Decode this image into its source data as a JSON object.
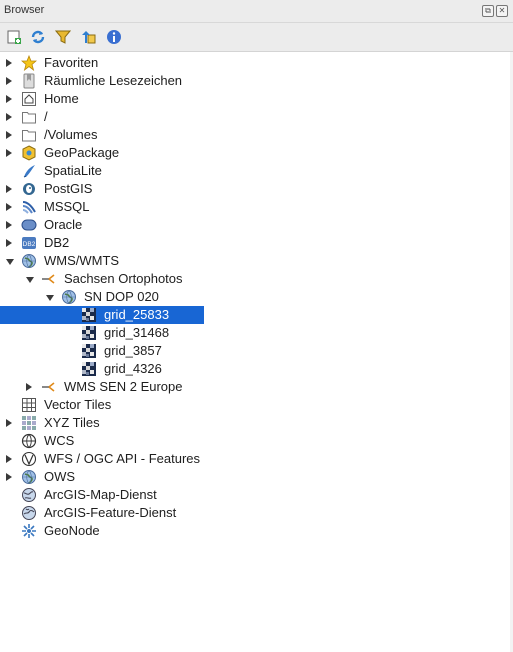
{
  "panel": {
    "title": "Browser"
  },
  "toolbar": {
    "icons": [
      "add-selected-icon",
      "refresh-icon",
      "filter-icon",
      "collapse-all-icon",
      "info-icon"
    ]
  },
  "tree": {
    "items": [
      {
        "label": "Favoriten",
        "icon": "star-icon",
        "expand": "collapsed"
      },
      {
        "label": "Räumliche Lesezeichen",
        "icon": "bookmark-icon",
        "expand": "collapsed"
      },
      {
        "label": "Home",
        "icon": "home-icon",
        "expand": "collapsed"
      },
      {
        "label": "/",
        "icon": "folder-icon",
        "expand": "collapsed"
      },
      {
        "label": "/Volumes",
        "icon": "folder-icon",
        "expand": "collapsed"
      },
      {
        "label": "GeoPackage",
        "icon": "geopackage-icon",
        "expand": "collapsed"
      },
      {
        "label": "SpatiaLite",
        "icon": "spatialite-icon",
        "expand": "none"
      },
      {
        "label": "PostGIS",
        "icon": "postgis-icon",
        "expand": "collapsed"
      },
      {
        "label": "MSSQL",
        "icon": "mssql-icon",
        "expand": "collapsed"
      },
      {
        "label": "Oracle",
        "icon": "oracle-icon",
        "expand": "collapsed"
      },
      {
        "label": "DB2",
        "icon": "db2-icon",
        "expand": "collapsed"
      },
      {
        "label": "WMS/WMTS",
        "icon": "globe-icon",
        "expand": "expanded"
      },
      {
        "label": "Sachsen Ortophotos",
        "icon": "connection-icon",
        "expand": "expanded"
      },
      {
        "label": "SN DOP 020",
        "icon": "globe-icon",
        "expand": "expanded"
      },
      {
        "label": "grid_25833",
        "icon": "raster-grid-icon",
        "expand": "none",
        "selected": true
      },
      {
        "label": "grid_31468",
        "icon": "raster-grid-icon",
        "expand": "none"
      },
      {
        "label": "grid_3857",
        "icon": "raster-grid-icon",
        "expand": "none"
      },
      {
        "label": "grid_4326",
        "icon": "raster-grid-icon",
        "expand": "none"
      },
      {
        "label": "WMS SEN 2 Europe",
        "icon": "connection-icon",
        "expand": "collapsed"
      },
      {
        "label": "Vector Tiles",
        "icon": "vector-tiles-icon",
        "expand": "none"
      },
      {
        "label": "XYZ Tiles",
        "icon": "xyz-tiles-icon",
        "expand": "collapsed"
      },
      {
        "label": "WCS",
        "icon": "wcs-icon",
        "expand": "none"
      },
      {
        "label": "WFS / OGC API - Features",
        "icon": "wfs-icon",
        "expand": "collapsed"
      },
      {
        "label": "OWS",
        "icon": "globe-icon",
        "expand": "collapsed"
      },
      {
        "label": "ArcGIS-Map-Dienst",
        "icon": "arcgis-map-icon",
        "expand": "none"
      },
      {
        "label": "ArcGIS-Feature-Dienst",
        "icon": "arcgis-feature-icon",
        "expand": "none"
      },
      {
        "label": "GeoNode",
        "icon": "geonode-icon",
        "expand": "none"
      }
    ]
  },
  "colors": {
    "selection": "#1866d4",
    "toolbar": "#ececec"
  }
}
